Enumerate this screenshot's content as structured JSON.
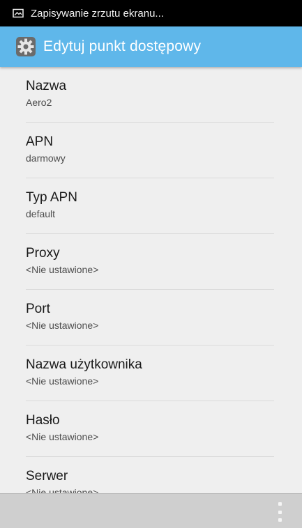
{
  "status_bar": {
    "notification_text": "Zapisywanie zrzutu ekranu...",
    "notification_icon": "image-icon"
  },
  "action_bar": {
    "title": "Edytuj punkt dostępowy",
    "icon": "settings-gear-icon",
    "color": "#5fb7ea"
  },
  "fields": [
    {
      "label": "Nazwa",
      "value": "Aero2"
    },
    {
      "label": "APN",
      "value": "darmowy"
    },
    {
      "label": "Typ APN",
      "value": "default"
    },
    {
      "label": "Proxy",
      "value": "<Nie ustawione>"
    },
    {
      "label": "Port",
      "value": "<Nie ustawione>"
    },
    {
      "label": "Nazwa użytkownika",
      "value": "<Nie ustawione>"
    },
    {
      "label": "Hasło",
      "value": "<Nie ustawione>"
    },
    {
      "label": "Serwer",
      "value": "<Nie ustawione>"
    }
  ],
  "bottom_bar": {
    "overflow_icon": "overflow-menu-icon"
  }
}
